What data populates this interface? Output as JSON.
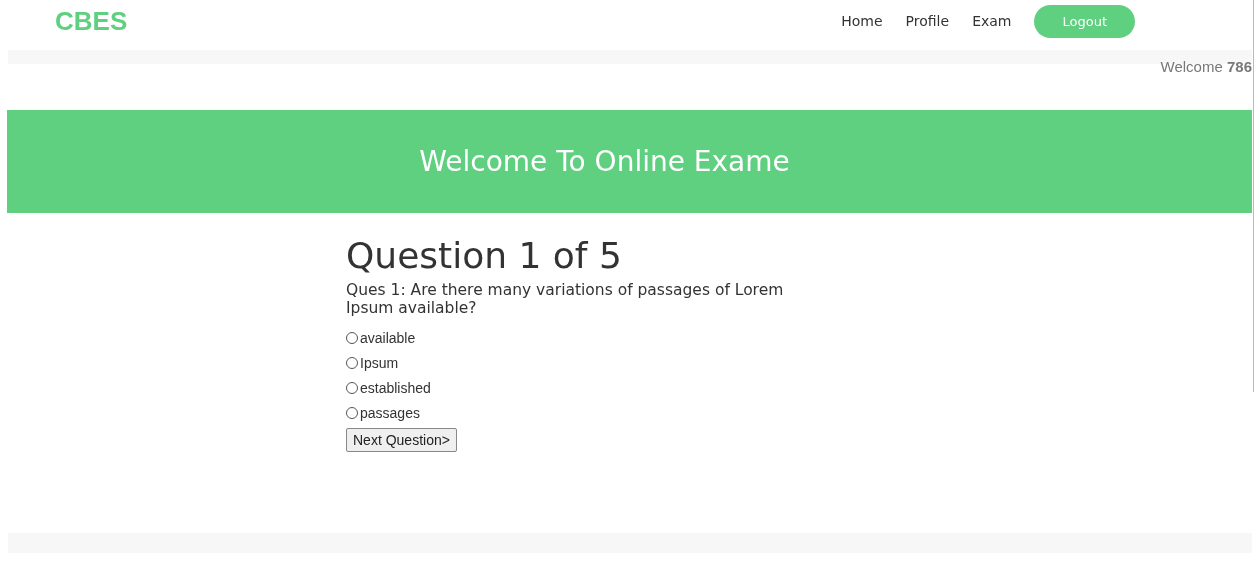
{
  "header": {
    "logo": "CBES",
    "nav": [
      {
        "label": "Home",
        "kind": "link"
      },
      {
        "label": "Profile",
        "kind": "link"
      },
      {
        "label": "Exam",
        "kind": "link"
      },
      {
        "label": "Logout",
        "kind": "button"
      }
    ]
  },
  "greeting": "Welcome **786**",
  "banner": {
    "title": "Welcome To Online Exame"
  },
  "quiz": {
    "heading": "Question 1 of 5",
    "question": "Ques 1: Are there many variations of passages of Lorem Ipsum available?",
    "options": [
      {
        "label": "available",
        "selected": false
      },
      {
        "label": "Ipsum",
        "selected": false
      },
      {
        "label": "established",
        "selected": false
      },
      {
        "label": "passages",
        "selected": false
      }
    ],
    "next_button": "Next Question>"
  }
}
